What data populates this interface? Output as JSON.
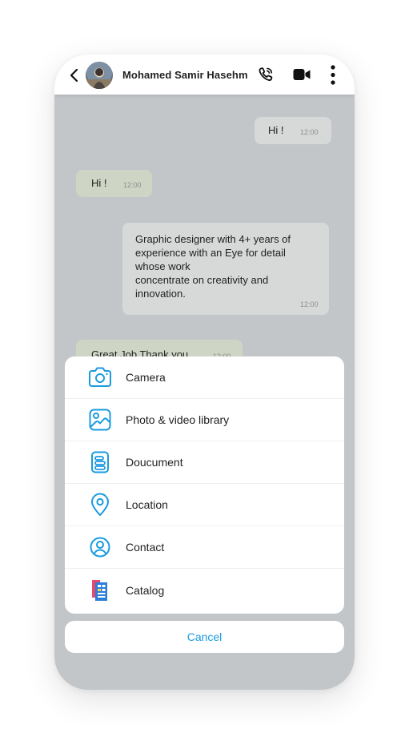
{
  "header": {
    "contact_name": "Mohamed Samir Hasehm",
    "back_icon": "chevron-left-icon",
    "call_icon": "phone-icon",
    "video_icon": "video-camera-icon",
    "menu_icon": "more-vertical-icon"
  },
  "messages": [
    {
      "text": "Hi !",
      "time": "12:00",
      "direction": "out"
    },
    {
      "text": "Hi !",
      "time": "12:00",
      "direction": "in"
    },
    {
      "lines": [
        "Graphic designer with 4+ years of",
        "experience with an Eye for detail",
        "whose work",
        "concentrate on creativity and",
        "innovation."
      ],
      "time": "12:00",
      "direction": "out"
    },
    {
      "text": "Great Job Thank you",
      "time": "12:00",
      "direction": "in"
    }
  ],
  "attach_menu": {
    "items": [
      {
        "label": "Camera",
        "icon": "camera-icon"
      },
      {
        "label": "Photo & video library",
        "icon": "image-icon"
      },
      {
        "label": "Doucument",
        "icon": "document-icon"
      },
      {
        "label": "Location",
        "icon": "location-pin-icon"
      },
      {
        "label": "Contact",
        "icon": "user-circle-icon"
      },
      {
        "label": "Catalog",
        "icon": "catalog-icon"
      }
    ],
    "cancel_label": "Cancel"
  },
  "colors": {
    "accent": "#1a9be0",
    "overlay": "#c2c6c9",
    "incoming_bubble": "#cfd5c4",
    "outgoing_bubble": "#d7d8d8"
  }
}
